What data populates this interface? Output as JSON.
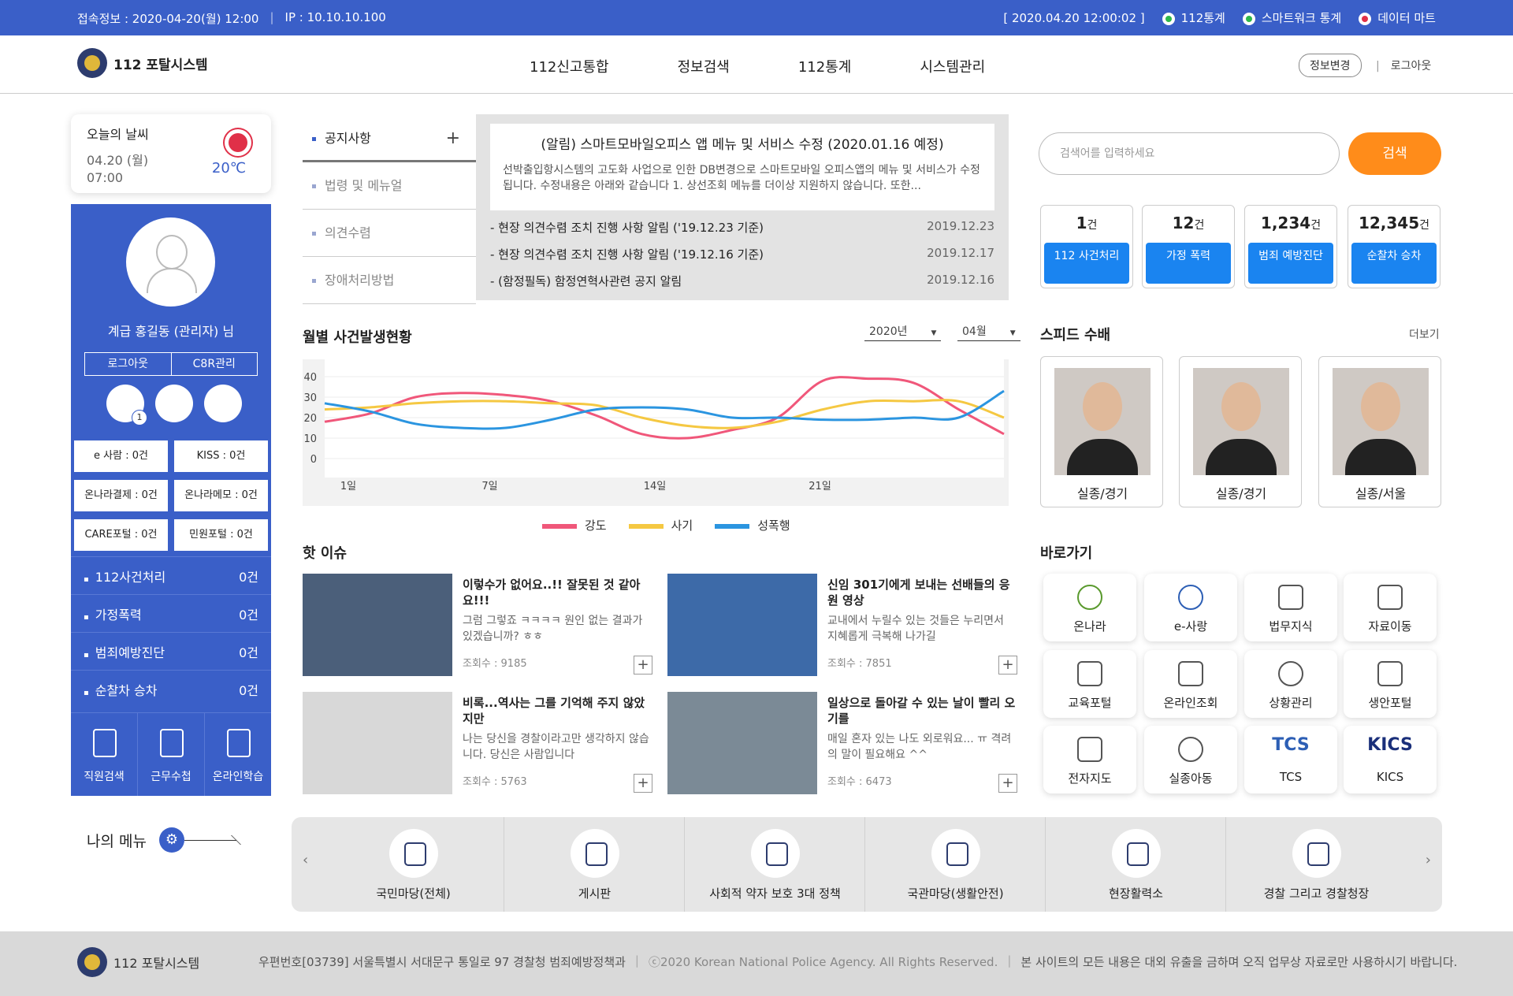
{
  "topbar": {
    "access": "접속정보 : 2020-04-20(월) 12:00",
    "ip": "IP : 10.10.10.100",
    "datetime": "[ 2020.04.20 12:00:02 ]",
    "links": [
      {
        "label": "112통계",
        "color": "#2db84b"
      },
      {
        "label": "스마트워크 통계",
        "color": "#2db84b"
      },
      {
        "label": "데이터 마트",
        "color": "#e03048"
      }
    ]
  },
  "header": {
    "logo": "112 포탈시스템",
    "nav": [
      "112신고통합",
      "정보검색",
      "112통계",
      "시스템관리"
    ],
    "info_btn": "정보변경",
    "logout": "로그아웃"
  },
  "weather": {
    "title": "오늘의 날씨",
    "date": "04.20 (월)",
    "time": "07:00",
    "temp": "20℃",
    "icon": "sun-icon"
  },
  "profile": {
    "name": "계급 홍길동 (관리자) 님",
    "btn_logout": "로그아웃",
    "btn_admin": "C8R관리",
    "mail_count": "1",
    "grid": [
      "e 사람 : 0건",
      "KISS : 0건",
      "온나라결제 : 0건",
      "온나라메모 : 0건",
      "CARE포털 : 0건",
      "민원포털 : 0건"
    ],
    "list": [
      {
        "label": "112사건처리",
        "count": "0건"
      },
      {
        "label": "가정폭력",
        "count": "0건"
      },
      {
        "label": "범죄예방진단",
        "count": "0건"
      },
      {
        "label": "순찰차 승차",
        "count": "0건"
      }
    ],
    "bottom": [
      "직원검색",
      "근무수첩",
      "온라인학습"
    ]
  },
  "mymenu": "나의 메뉴",
  "notice": {
    "tabs": [
      "공지사항",
      "법령 및 메뉴얼",
      "의견수렴",
      "장애처리방법"
    ],
    "main_title": "(알림) 스마트모바일오피스 앱 메뉴 및 서비스 수정 (2020.01.16 예정)",
    "main_body": "선박출입항시스템의 고도화 사업으로 인한 DB변경으로 스마트모바일 오피스앱의 메뉴 및 서비스가 수정됩니다. 수정내용은 아래와 같습니다 1. 상선조회 메뉴를 더이상 지원하지 않습니다. 또한...",
    "rows": [
      {
        "title": "- 현장 의견수렴 조치 진행 사항 알림 ('19.12.23 기준)",
        "date": "2019.12.23"
      },
      {
        "title": "- 현장 의견수렴 조치 진행 사항 알림 ('19.12.16 기준)",
        "date": "2019.12.17"
      },
      {
        "title": "- (함정필독) 함정연혁사관련 공지 알림",
        "date": "2019.12.16"
      }
    ]
  },
  "chart_title": "월별 사건발생현황",
  "year": "2020년",
  "month": "04월",
  "chart_data": {
    "type": "line",
    "x": [
      0,
      1,
      4,
      7,
      10,
      14,
      17,
      19,
      21,
      24,
      27
    ],
    "xticks": [
      {
        "v": 1,
        "label": "1일"
      },
      {
        "v": 7,
        "label": "7일"
      },
      {
        "v": 14,
        "label": "14일"
      },
      {
        "v": 21,
        "label": "21일"
      }
    ],
    "yticks": [
      0,
      10,
      20,
      30,
      40
    ],
    "ylim": [
      0,
      40
    ],
    "xlim": [
      0,
      28.8
    ],
    "series": [
      {
        "name": "강도",
        "color": "#f0577a",
        "values": [
          18,
          22,
          30,
          32,
          31,
          28,
          21,
          12,
          10,
          14,
          20,
          38,
          39,
          37,
          24,
          12
        ]
      },
      {
        "name": "사기",
        "color": "#f5c842",
        "values": [
          24,
          25,
          27,
          28,
          28,
          27,
          26,
          20,
          16,
          15,
          18,
          24,
          28,
          28,
          28,
          20
        ]
      },
      {
        "name": "성폭행",
        "color": "#2b95e0",
        "values": [
          27,
          23,
          17,
          15,
          15,
          19,
          24,
          25,
          24,
          20,
          20,
          19,
          19,
          20,
          20,
          33
        ]
      }
    ]
  },
  "hot_title": "핫 이슈",
  "issues": [
    {
      "title": "이렇수가 없어요..!! 잘못된 것 같아요!!!",
      "sub": "그럼 그렇죠 ㅋㅋㅋㅋ 원인 없는 결과가 있겠습니까? ㅎㅎ",
      "views": "조회수 : 9185"
    },
    {
      "title": "신임 301기에게 보내는 선배들의 응원 영상",
      "sub": "교내에서 누릴수 있는 것들은 누리면서 지혜롭게 극복해 나가길",
      "views": "조회수 : 7851"
    },
    {
      "title": "비록...역사는 그를 기억해 주지 않았지만",
      "sub": "나는 당신을 경찰이라고만 생각하지 않습니다. 당신은 사람입니다",
      "views": "조회수 : 5763"
    },
    {
      "title": "일상으로 돌아갈 수 있는 날이 빨리 오기를",
      "sub": "매일 혼자 있는 나도 외로워요... ㅠ 격려의 말이 필요해요 ^^",
      "views": "조회수 : 6473"
    }
  ],
  "search": {
    "placeholder": "검색어를 입력하세요",
    "btn": "검색"
  },
  "stats": [
    {
      "num": "1",
      "unit": "건",
      "label": "112 사건처리"
    },
    {
      "num": "12",
      "unit": "건",
      "label": "가정 폭력"
    },
    {
      "num": "1,234",
      "unit": "건",
      "label": "범죄 예방진단"
    },
    {
      "num": "12,345",
      "unit": "건",
      "label": "순찰차 승차"
    }
  ],
  "speed": {
    "title": "스피드 수배",
    "more": "더보기",
    "items": [
      "실종/경기",
      "실종/경기",
      "실종/서울"
    ]
  },
  "quick": {
    "title": "바로가기",
    "items": [
      "온나라",
      "e-사랑",
      "법무지식",
      "자료이동",
      "교육포털",
      "온라인조회",
      "상황관리",
      "생안포털",
      "전자지도",
      "실종아동",
      "TCS",
      "KICS"
    ],
    "logo_tcs": "TCS",
    "logo_kics": "KICS"
  },
  "carousel": [
    "국민마당(전체)",
    "게시판",
    "사회적 약자 보호 3대 정책",
    "국관마당(생활안전)",
    "현장활력소",
    "경찰 그리고 경찰청장"
  ],
  "footer": {
    "logo": "112 포탈시스템",
    "address": "우편번호[03739] 서울특별시 서대문구 통일로 97 경찰청 범죄예방정책과",
    "copy": "ⓒ2020 Korean National Police Agency. All Rights Reserved.",
    "notice": "본 사이트의 모든 내용은 대외 유출을 금하며 오직 업무상 자료로만 사용하시기 바랍니다."
  }
}
